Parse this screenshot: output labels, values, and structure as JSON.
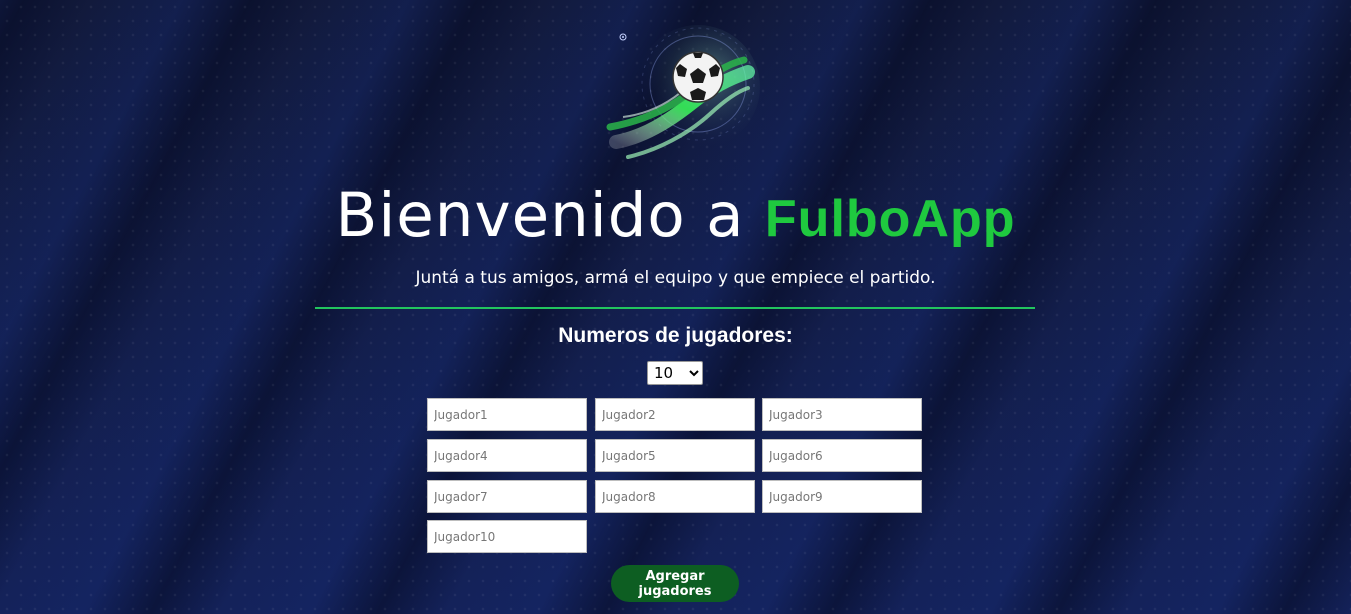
{
  "header": {
    "title_prefix": "Bienvenido a",
    "title_brand": "FulboApp",
    "tagline": "Juntá a tus amigos, armá el equipo y que empiece el partido."
  },
  "form": {
    "section_title": "Numeros de jugadores:",
    "player_count": {
      "selected": "10",
      "options": [
        "10"
      ]
    },
    "players": [
      {
        "placeholder": "Jugador1",
        "value": ""
      },
      {
        "placeholder": "Jugador2",
        "value": ""
      },
      {
        "placeholder": "Jugador3",
        "value": ""
      },
      {
        "placeholder": "Jugador4",
        "value": ""
      },
      {
        "placeholder": "Jugador5",
        "value": ""
      },
      {
        "placeholder": "Jugador6",
        "value": ""
      },
      {
        "placeholder": "Jugador7",
        "value": ""
      },
      {
        "placeholder": "Jugador8",
        "value": ""
      },
      {
        "placeholder": "Jugador9",
        "value": ""
      },
      {
        "placeholder": "Jugador10",
        "value": ""
      }
    ],
    "submit_label": "Agregar jugadores"
  },
  "colors": {
    "brand_green": "#1fc93f",
    "divider_green": "#22c55e",
    "button_green": "#0d5e22",
    "background_navy": "#0f1a45"
  },
  "icons": {
    "logo": "soccer-ball-icon"
  }
}
